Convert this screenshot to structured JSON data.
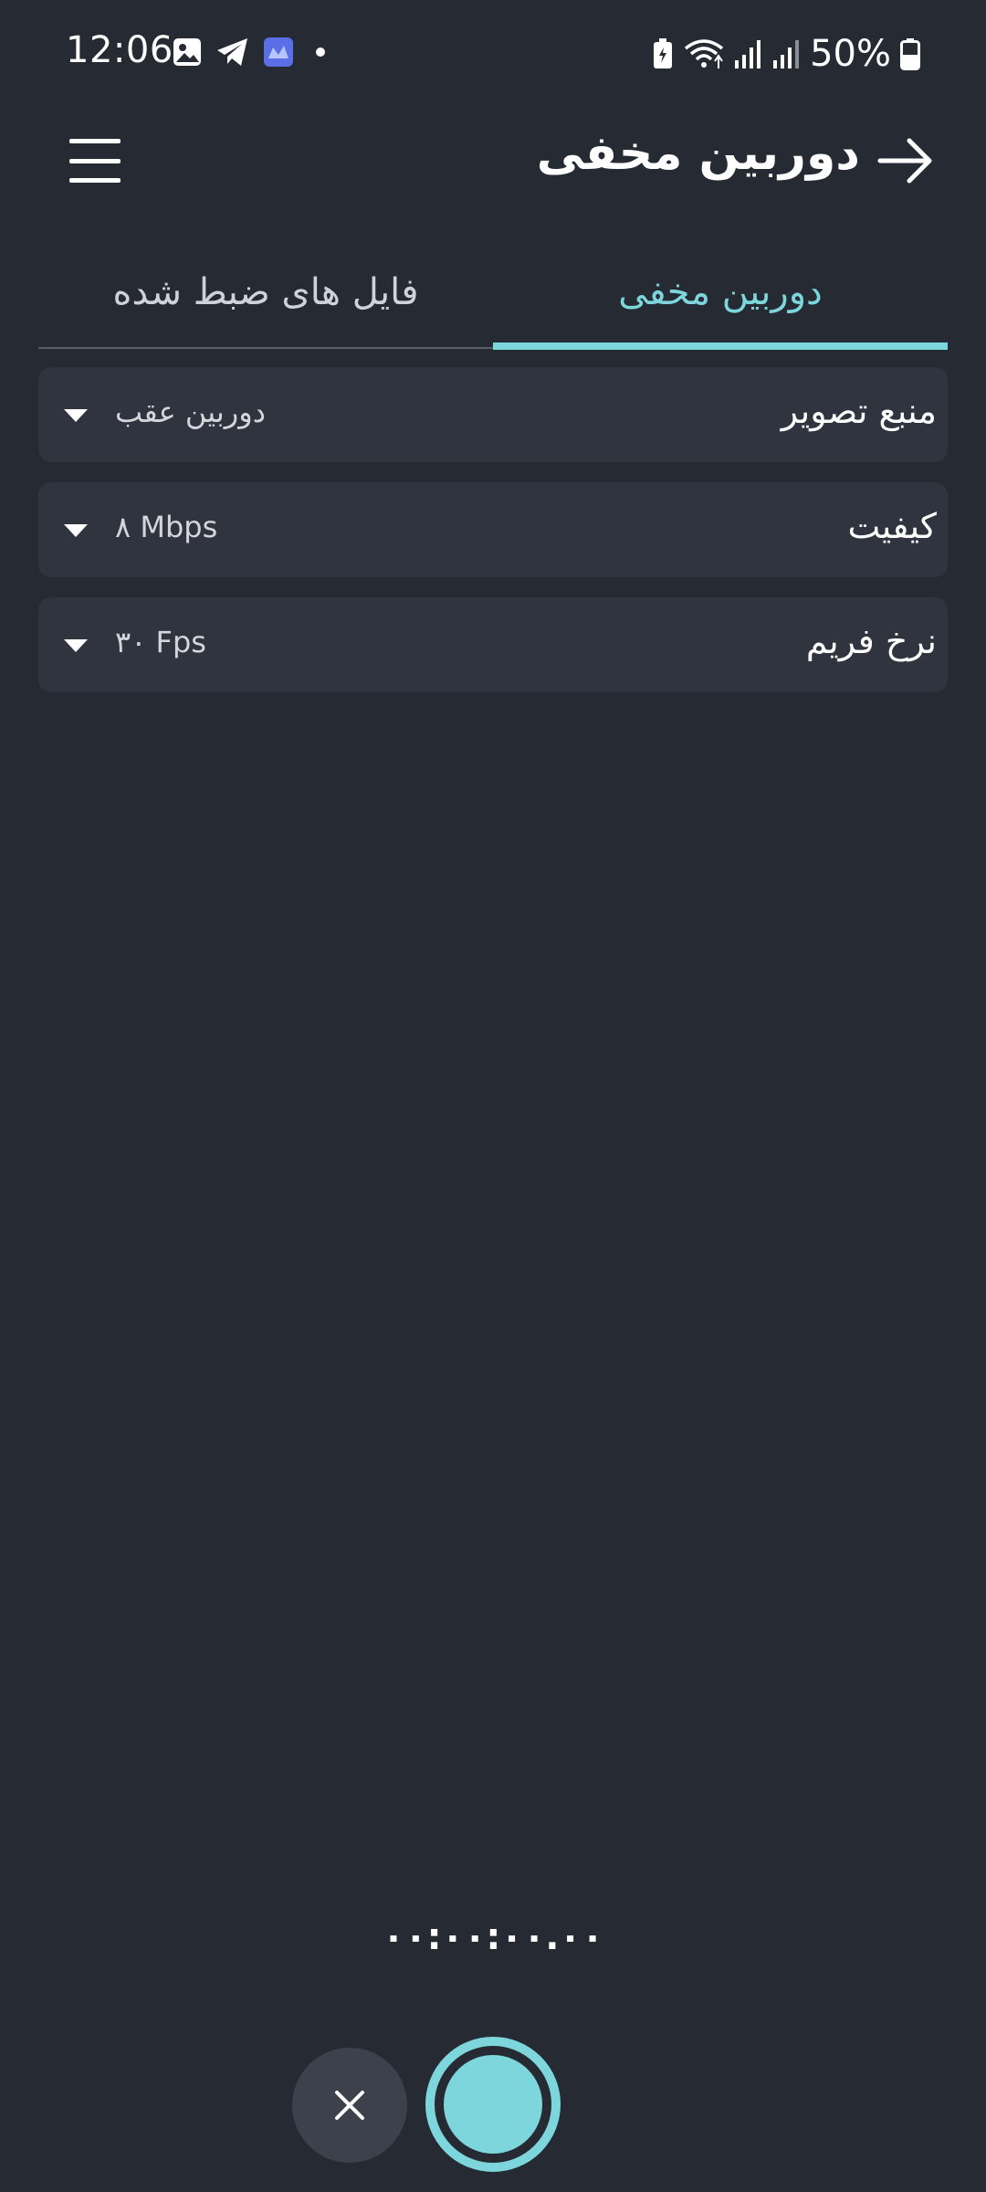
{
  "status_bar": {
    "time": "12:06",
    "battery": "50%",
    "left_icons": [
      "gallery-icon",
      "telegram-icon",
      "app-icon",
      "notification-dot"
    ],
    "right_icons": [
      "battery-saver-icon",
      "wifi-icon",
      "signal-icon",
      "signal-icon-2",
      "battery-icon"
    ]
  },
  "header": {
    "title": "دوربین مخفی",
    "back_icon": "arrow-right-icon",
    "menu_icon": "hamburger-menu-icon"
  },
  "tabs": [
    {
      "label": "دوربین مخفی",
      "active": true
    },
    {
      "label": "فایل های ضبط شده",
      "active": false
    }
  ],
  "settings": [
    {
      "label": "منبع تصویر",
      "value": "دوربین عقب"
    },
    {
      "label": "کیفیت",
      "value": "۸ Mbps"
    },
    {
      "label": "نرخ فریم",
      "value": "۳۰ Fps"
    }
  ],
  "timer": "۰۰:۰۰:۰۰.۰۰",
  "colors": {
    "background": "#262a33",
    "card": "#30343f",
    "accent": "#7dd6dc",
    "cancel_bg": "#3c414c"
  }
}
